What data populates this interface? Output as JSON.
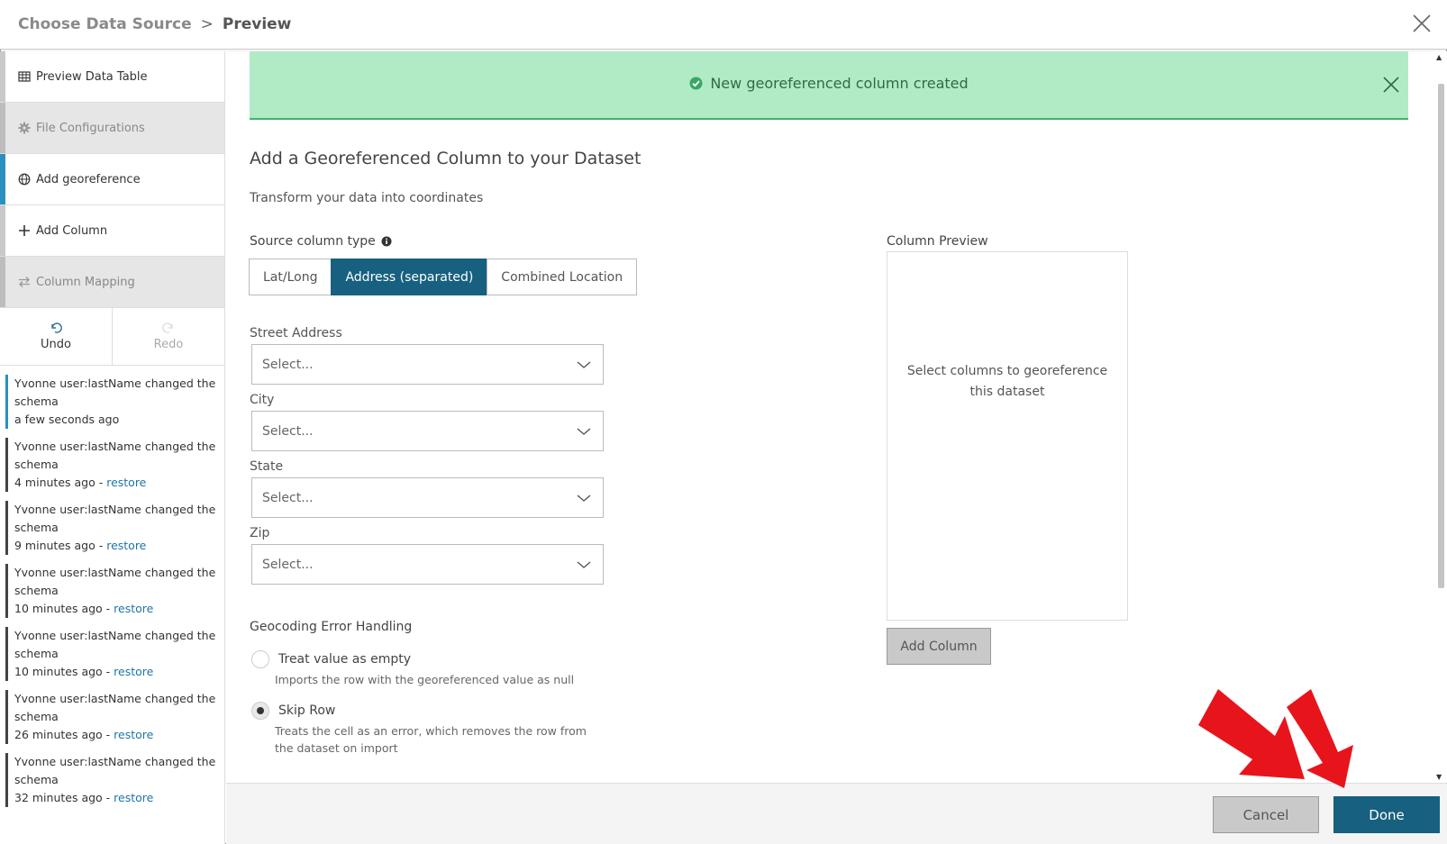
{
  "header": {
    "breadcrumb_parent": "Choose Data Source",
    "breadcrumb_separator": ">",
    "breadcrumb_current": "Preview",
    "close_icon": "close-icon"
  },
  "sidebar": {
    "items": [
      {
        "label": "Preview Data Table",
        "icon": "table-icon"
      },
      {
        "label": "File Configurations",
        "icon": "gear-icon"
      },
      {
        "label": "Add georeference",
        "icon": "globe-icon"
      },
      {
        "label": "Add Column",
        "icon": "plus-icon"
      },
      {
        "label": "Column Mapping",
        "icon": "swap-icon"
      }
    ],
    "undo_label": "Undo",
    "redo_label": "Redo",
    "history": [
      {
        "text": "Yvonne user:lastName changed the schema",
        "time": "a few seconds ago",
        "restore": ""
      },
      {
        "text": "Yvonne user:lastName changed the schema",
        "time": "4 minutes ago - ",
        "restore": "restore"
      },
      {
        "text": "Yvonne user:lastName changed the schema",
        "time": "9 minutes ago - ",
        "restore": "restore"
      },
      {
        "text": "Yvonne user:lastName changed the schema",
        "time": "10 minutes ago - ",
        "restore": "restore"
      },
      {
        "text": "Yvonne user:lastName changed the schema",
        "time": "10 minutes ago - ",
        "restore": "restore"
      },
      {
        "text": "Yvonne user:lastName changed the schema",
        "time": "26 minutes ago - ",
        "restore": "restore"
      },
      {
        "text": "Yvonne user:lastName changed the schema",
        "time": "32 minutes ago - ",
        "restore": "restore"
      }
    ]
  },
  "banner": {
    "message": "New georeferenced column created",
    "color": "#b1ebc6"
  },
  "main": {
    "title": "Add a Georeferenced Column to your Dataset",
    "subtitle": "Transform your data into coordinates",
    "source_type_label": "Source column type",
    "source_types": [
      "Lat/Long",
      "Address (separated)",
      "Combined Location"
    ],
    "selected_source_type": "Address (separated)",
    "fields": [
      {
        "label": "Street Address",
        "placeholder": "Select..."
      },
      {
        "label": "City",
        "placeholder": "Select..."
      },
      {
        "label": "State",
        "placeholder": "Select..."
      },
      {
        "label": "Zip",
        "placeholder": "Select..."
      }
    ],
    "error_handling_title": "Geocoding Error Handling",
    "error_options": [
      {
        "label": "Treat value as empty",
        "desc": "Imports the row with the georeferenced value as null",
        "selected": false
      },
      {
        "label": "Skip Row",
        "desc": "Treats the cell as an error, which removes the row from the dataset on import",
        "selected": true
      }
    ],
    "preview_label": "Column Preview",
    "preview_placeholder": "Select columns to georeference this dataset",
    "add_column_label": "Add Column"
  },
  "footer": {
    "cancel_label": "Cancel",
    "done_label": "Done",
    "accent_color": "#17607f"
  }
}
